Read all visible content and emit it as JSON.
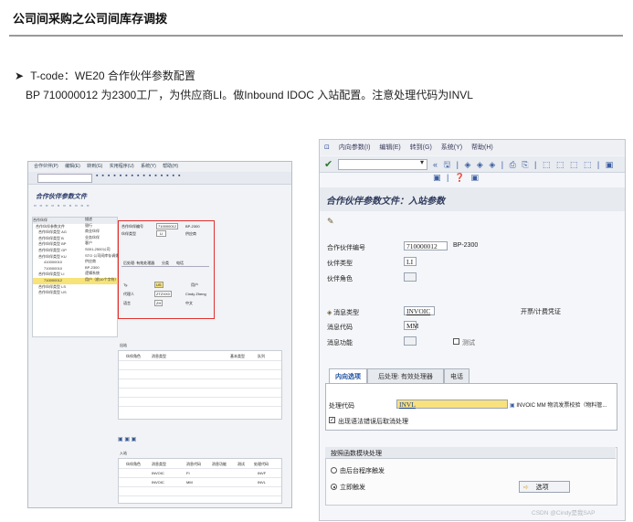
{
  "slide": {
    "title": "公司间采购之公司间库存调拨",
    "bullet_marker": "➤",
    "line1": "T-code：WE20 合作伙伴参数配置",
    "line2": "BP 710000012 为2300工厂，为供应商LI。做Inbound IDOC 入站配置。注意处理代码为INVL"
  },
  "right_screen": {
    "menu": [
      "内向参数(I)",
      "编辑(E)",
      "转到(G)",
      "系统(Y)",
      "帮助(H)"
    ],
    "icons": "« 🖫 | ◈ ◈ ◈ | ⎙ ⎘ | ⬚ ⬚ ⬚ ⬚ | ▣ ▣ | ❓ ▣",
    "screen_title": "合作伙伴参数文件：入站参数",
    "partner_no_label": "合作伙伴编号",
    "partner_no": "710000012",
    "partner_name": "BP-2300",
    "partner_type_label": "伙伴类型",
    "partner_type": "LI",
    "partner_role_label": "伙伴角色",
    "msg_type_label": "消息类型",
    "msg_type": "INVOIC",
    "msg_type_desc": "开票/计费凭证",
    "msg_code_label": "消息代码",
    "msg_code": "MM",
    "msg_function_label": "消息功能",
    "test_label": "测试",
    "tabs": [
      "内向选项",
      "后处理: 有效处理器",
      "电话"
    ],
    "process_code_label": "处理代码",
    "process_code": "INVL",
    "process_code_desc": "INVOIC MM  物流发票校验（物料管...",
    "cancel_label": "出现语法错误后取消处理",
    "group_title": "按照函数模块处理",
    "radio1": "由后台程序触发",
    "radio2": "立即触发",
    "options_button": "选项",
    "watermark": "CSDN @Cindy是我SAP"
  },
  "left_screen": {
    "menu": [
      "合作伙伴(P)",
      "编辑(E)",
      "转到(G)",
      "实用程序(U)",
      "系统(Y)",
      "帮助(H)"
    ],
    "screen_title": "合作伙伴参数文件",
    "tree_header": "合作伙伴",
    "tree_header2": "描述",
    "tree": [
      "合作伙伴参数文件",
      "合作伙伴类型 AG",
      "合作伙伴类型 B",
      "合作伙伴类型 BP",
      "合作伙伴类型 GP",
      "合作伙伴类型 KU",
      "410000010",
      "710000010",
      "合作伙伴类型 LI",
      "710000012",
      "合作伙伴类型 LS",
      "合作伙伴类型 US"
    ],
    "tree_desc": [
      "",
      "",
      "银行",
      "商业伙伴",
      "业务伙伴",
      "客户",
      "S001-2500公司",
      "STO 公司间库存调拨",
      "供应商",
      "BP-2300",
      "逻辑系统",
      "用户（前10个字符）"
    ],
    "detail": {
      "partner_no_label": "合作伙伴编号",
      "partner_no": "710000012",
      "partner_name": "BP-2300",
      "partner_type_label": "伙伴类型",
      "partner_type": "LI",
      "partner_type_desc": "供应商",
      "tabs": [
        "后处理: 有效处理器",
        "分类",
        "电话"
      ],
      "type_label": "Ty.",
      "type_value": "US",
      "user_label": "用户",
      "agent_label": "代理人",
      "agent": "ZTZXX0",
      "agent_name": "Cindy Zheng",
      "lang_label": "语言",
      "lang": "ZH",
      "lang_desc": "中文"
    },
    "outbound_label": "出站",
    "outbound_cols": [
      "伙伴角色",
      "消息类型",
      "",
      "基本类型",
      "队列"
    ],
    "inbound_label": "入站",
    "inbound_cols": [
      "伙伴角色",
      "消息类型",
      "消息代码",
      "消息功能",
      "测试",
      "处理代码"
    ],
    "inbound_rows": [
      [
        "",
        "INVOIC",
        "FI",
        "",
        "",
        "INVF"
      ],
      [
        "",
        "INVOIC",
        "MM",
        "",
        "",
        "INVL"
      ]
    ]
  }
}
